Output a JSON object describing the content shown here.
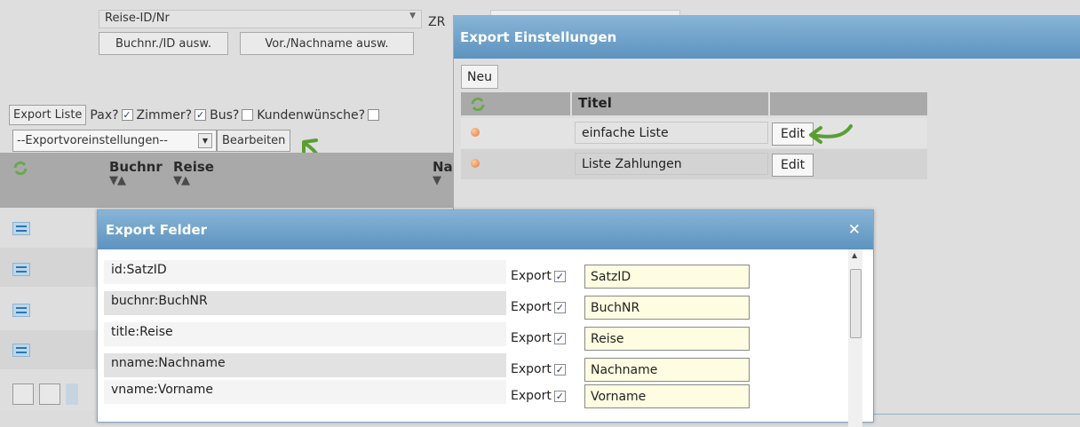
{
  "background": {
    "select_value": "Reise-ID/Nr",
    "btn_buchnr": "Buchnr./ID ausw.",
    "btn_name": "Vor./Nachname ausw.",
    "zr_label": "ZR",
    "export_list_btn": "Export Liste",
    "options": [
      {
        "label": "Pax?",
        "checked": true
      },
      {
        "label": "Zimmer?",
        "checked": true
      },
      {
        "label": "Bus?",
        "checked": false
      },
      {
        "label": "Kundenwünsche?",
        "checked": false
      }
    ],
    "preset_select": "--Exportvoreinstellungen--",
    "bearbeiten_btn": "Bearbeiten",
    "grid_columns": [
      "Buchnr",
      "Reise",
      "Na"
    ]
  },
  "export_settings": {
    "title": "Export Einstellungen",
    "new_btn": "Neu",
    "col_title": "Titel",
    "rows": [
      {
        "title": "einfache Liste",
        "edit": "Edit"
      },
      {
        "title": "Liste Zahlungen",
        "edit": "Edit"
      }
    ]
  },
  "export_fields": {
    "title": "Export Felder",
    "export_label": "Export",
    "rows": [
      {
        "field": "id:SatzID",
        "value": "SatzID",
        "checked": true
      },
      {
        "field": "buchnr:BuchNR",
        "value": "BuchNR",
        "checked": true
      },
      {
        "field": "title:Reise",
        "value": "Reise",
        "checked": true
      },
      {
        "field": "nname:Nachname",
        "value": "Nachname",
        "checked": true
      },
      {
        "field": "vname:Vorname",
        "value": "Vorname",
        "checked": true
      }
    ]
  },
  "colors": {
    "titlebar": "#6fa2c9",
    "accent_green": "#5a9e33",
    "input_bg": "#fffde1",
    "header_gray": "#a9a9a9"
  }
}
